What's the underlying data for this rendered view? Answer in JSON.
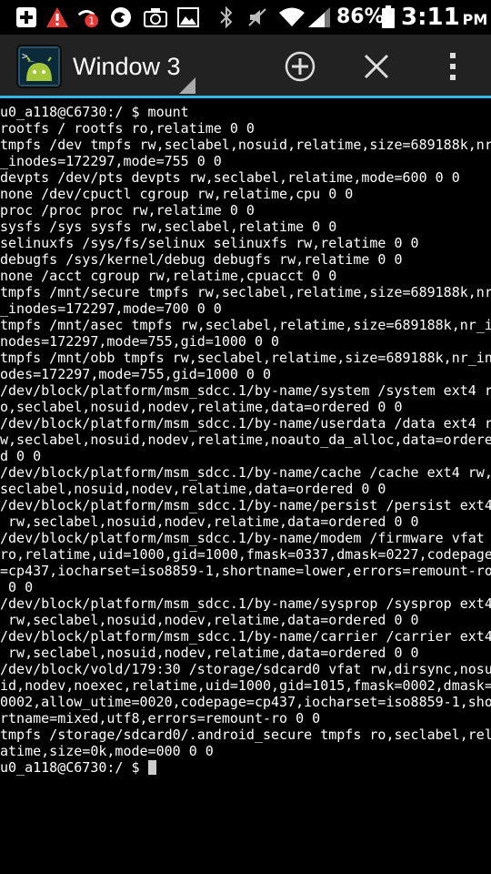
{
  "status_bar": {
    "battery_percent": "86%",
    "time": "3:11",
    "ampm": "PM",
    "notification_badge": "1",
    "icons": [
      "add-icon",
      "warning-icon",
      "missed-call-icon",
      "firefox-icon",
      "camera-icon",
      "gallery-icon",
      "bluetooth-icon",
      "mute-icon",
      "wifi-icon",
      "signal-icon",
      "battery-icon"
    ]
  },
  "action_bar": {
    "title": "Window 3",
    "buttons": [
      "new-window-icon",
      "close-window-icon",
      "overflow-menu-icon"
    ]
  },
  "colors": {
    "accent": "#33b5e5",
    "terminal_bg": "#000000",
    "terminal_fg": "#ffffff"
  },
  "terminal": {
    "lines": [
      "u0_a118@C6730:/ $ mount",
      "rootfs / rootfs ro,relatime 0 0",
      "tmpfs /dev tmpfs rw,seclabel,nosuid,relatime,size=689188k,nr",
      "_inodes=172297,mode=755 0 0",
      "devpts /dev/pts devpts rw,seclabel,relatime,mode=600 0 0",
      "none /dev/cpuctl cgroup rw,relatime,cpu 0 0",
      "proc /proc proc rw,relatime 0 0",
      "sysfs /sys sysfs rw,seclabel,relatime 0 0",
      "selinuxfs /sys/fs/selinux selinuxfs rw,relatime 0 0",
      "debugfs /sys/kernel/debug debugfs rw,relatime 0 0",
      "none /acct cgroup rw,relatime,cpuacct 0 0",
      "tmpfs /mnt/secure tmpfs rw,seclabel,relatime,size=689188k,nr",
      "_inodes=172297,mode=700 0 0",
      "tmpfs /mnt/asec tmpfs rw,seclabel,relatime,size=689188k,nr_i",
      "nodes=172297,mode=755,gid=1000 0 0",
      "tmpfs /mnt/obb tmpfs rw,seclabel,relatime,size=689188k,nr_in",
      "odes=172297,mode=755,gid=1000 0 0",
      "/dev/block/platform/msm_sdcc.1/by-name/system /system ext4 r",
      "o,seclabel,nosuid,nodev,relatime,data=ordered 0 0",
      "/dev/block/platform/msm_sdcc.1/by-name/userdata /data ext4 r",
      "w,seclabel,nosuid,nodev,relatime,noauto_da_alloc,data=ordere",
      "d 0 0",
      "/dev/block/platform/msm_sdcc.1/by-name/cache /cache ext4 rw,",
      "seclabel,nosuid,nodev,relatime,data=ordered 0 0",
      "/dev/block/platform/msm_sdcc.1/by-name/persist /persist ext4",
      " rw,seclabel,nosuid,nodev,relatime,data=ordered 0 0",
      "/dev/block/platform/msm_sdcc.1/by-name/modem /firmware vfat",
      "ro,relatime,uid=1000,gid=1000,fmask=0337,dmask=0227,codepage",
      "=cp437,iocharset=iso8859-1,shortname=lower,errors=remount-ro",
      " 0 0",
      "/dev/block/platform/msm_sdcc.1/by-name/sysprop /sysprop ext4",
      " rw,seclabel,nosuid,nodev,relatime,data=ordered 0 0",
      "/dev/block/platform/msm_sdcc.1/by-name/carrier /carrier ext4",
      " rw,seclabel,nosuid,nodev,relatime,data=ordered 0 0",
      "/dev/block/vold/179:30 /storage/sdcard0 vfat rw,dirsync,nosu",
      "id,nodev,noexec,relatime,uid=1000,gid=1015,fmask=0002,dmask=",
      "0002,allow_utime=0020,codepage=cp437,iocharset=iso8859-1,sho",
      "rtname=mixed,utf8,errors=remount-ro 0 0",
      "tmpfs /storage/sdcard0/.android_secure tmpfs ro,seclabel,rel",
      "atime,size=0k,mode=000 0 0"
    ],
    "prompt": "u0_a118@C6730:/ $ "
  }
}
